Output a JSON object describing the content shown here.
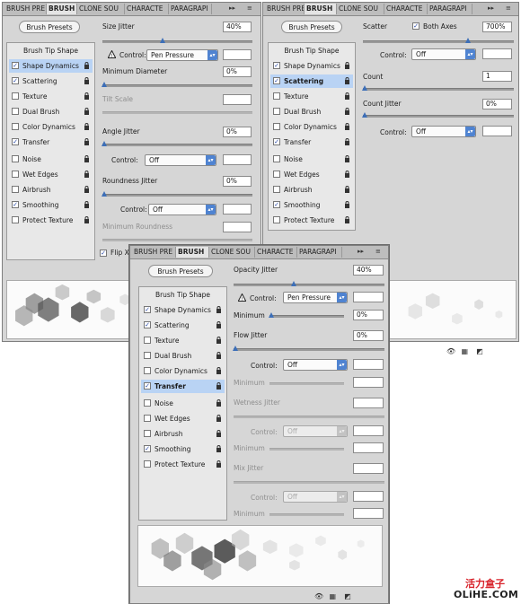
{
  "tabs": [
    "BRUSH PRE",
    "BRUSH",
    "CLONE SOU",
    "CHARACTE",
    "PARAGRAPI"
  ],
  "brush_presets": "Brush Presets",
  "brush_tip_shape": "Brush Tip Shape",
  "options": [
    "Shape Dynamics",
    "Scattering",
    "Texture",
    "Dual Brush",
    "Color Dynamics",
    "Transfer",
    "Noise",
    "Wet Edges",
    "Airbrush",
    "Smoothing",
    "Protect Texture"
  ],
  "panel1": {
    "size_jitter": "Size Jitter",
    "size_jitter_value": "40%",
    "control": "Control:",
    "control_value": "Pen Pressure",
    "minimum_diameter": "Minimum Diameter",
    "minimum_diameter_value": "0%",
    "tilt_scale": "Tilt Scale",
    "angle_jitter": "Angle Jitter",
    "angle_jitter_value": "0%",
    "control2": "Control:",
    "control2_value": "Off",
    "roundness_jitter": "Roundness Jitter",
    "roundness_jitter_value": "0%",
    "control3": "Control:",
    "control3_value": "Off",
    "minimum_roundness": "Minimum Roundness",
    "flip_x": "Flip X"
  },
  "panel2": {
    "scatter": "Scatter",
    "both_axes": "Both Axes",
    "scatter_value": "700%",
    "control": "Control:",
    "control_value": "Off",
    "count": "Count",
    "count_value": "1",
    "count_jitter": "Count Jitter",
    "count_jitter_value": "0%",
    "control2": "Control:",
    "control2_value": "Off"
  },
  "panel3": {
    "opacity_jitter": "Opacity Jitter",
    "opacity_jitter_value": "40%",
    "control": "Control:",
    "control_value": "Pen Pressure",
    "minimum": "Minimum",
    "minimum_value": "0%",
    "flow_jitter": "Flow Jitter",
    "flow_jitter_value": "0%",
    "control2": "Control:",
    "control2_value": "Off",
    "minimum2": "Minimum",
    "wetness_jitter": "Wetness Jitter",
    "control3": "Control:",
    "control3_value": "Off",
    "minimum3": "Minimum",
    "mix_jitter": "Mix Jitter",
    "control4": "Control:",
    "control4_value": "Off",
    "minimum4": "Minimum"
  },
  "watermark": {
    "cn": "活力盒子",
    "en": "OLiHE.COM"
  },
  "colors": {
    "accent": "#4f83d1",
    "selected_row": "#b9d3f4",
    "panel_bg": "#d6d6d6",
    "watermark": "#d8222a"
  }
}
